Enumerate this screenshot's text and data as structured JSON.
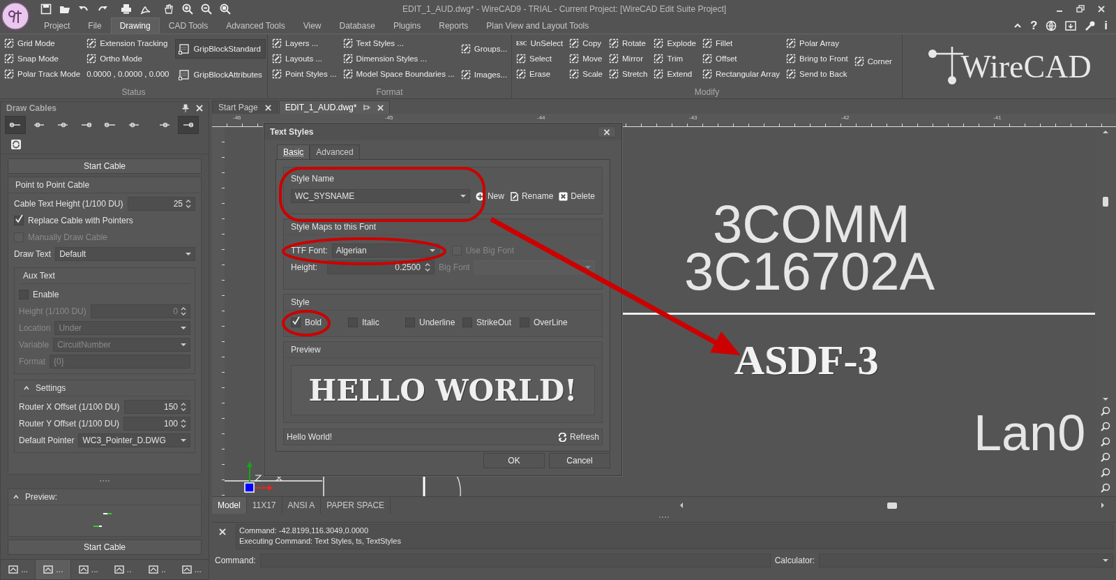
{
  "title_bar": {
    "title": "EDIT_1_AUD.dwg* - WireCAD9 - TRIAL - Current Project: [WireCAD Edit Suite Project]",
    "help": "?",
    "info": "i"
  },
  "menu_tabs": [
    {
      "label": "Project",
      "selected": false
    },
    {
      "label": "File",
      "selected": false
    },
    {
      "label": "Drawing",
      "selected": true
    },
    {
      "label": "CAD Tools",
      "selected": false
    },
    {
      "label": "Advanced Tools",
      "selected": false
    },
    {
      "label": "View",
      "selected": false
    },
    {
      "label": "Database",
      "selected": false
    },
    {
      "label": "Plugins",
      "selected": false
    },
    {
      "label": "Reports",
      "selected": false
    },
    {
      "label": "Plan View and Layout Tools",
      "selected": false
    }
  ],
  "ribbon": {
    "groups": [
      {
        "title": "Status",
        "columns": [
          {
            "items": [
              {
                "kind": "command",
                "label": "Grid Mode"
              },
              {
                "kind": "command",
                "label": "Snap Mode"
              },
              {
                "kind": "command",
                "label": "Polar Track Mode"
              }
            ]
          },
          {
            "items": [
              {
                "kind": "command",
                "label": "Extension Tracking"
              },
              {
                "kind": "command",
                "label": "Ortho Mode"
              },
              {
                "kind": "readout",
                "label": "0.0000 , 0.0000 , 0.000"
              }
            ]
          },
          {
            "items": [
              {
                "kind": "toggle",
                "label": "GripBlockStandard",
                "on": true
              },
              {
                "kind": "toggle",
                "label": "GripBlockAttributes",
                "on": false
              }
            ]
          }
        ]
      },
      {
        "title": "Format",
        "columns": [
          {
            "items": [
              {
                "kind": "command",
                "label": "Layers ..."
              },
              {
                "kind": "command",
                "label": "Layouts ..."
              },
              {
                "kind": "command",
                "label": "Point Styles ..."
              }
            ]
          },
          {
            "items": [
              {
                "kind": "command",
                "label": "Text Styles ..."
              },
              {
                "kind": "command",
                "label": "Dimension Styles ..."
              },
              {
                "kind": "command",
                "label": "Model Space Boundaries ..."
              }
            ]
          },
          {
            "items": [
              {
                "kind": "command",
                "label": "Groups..."
              },
              {
                "kind": "command",
                "label": "Images..."
              }
            ]
          }
        ]
      },
      {
        "title": "Modify",
        "columns": [
          {
            "items": [
              {
                "kind": "command",
                "label": "UnSelect",
                "key": "ESC"
              },
              {
                "kind": "command",
                "label": "Select"
              },
              {
                "kind": "command",
                "label": "Erase"
              }
            ]
          },
          {
            "items": [
              {
                "kind": "command",
                "label": "Copy"
              },
              {
                "kind": "command",
                "label": "Move"
              },
              {
                "kind": "command",
                "label": "Scale"
              }
            ]
          },
          {
            "items": [
              {
                "kind": "command",
                "label": "Rotate"
              },
              {
                "kind": "command",
                "label": "Mirror"
              },
              {
                "kind": "command",
                "label": "Stretch"
              }
            ]
          },
          {
            "items": [
              {
                "kind": "command",
                "label": "Explode"
              },
              {
                "kind": "command",
                "label": "Trim"
              },
              {
                "kind": "command",
                "label": "Extend"
              }
            ]
          },
          {
            "items": [
              {
                "kind": "command",
                "label": "Fillet"
              },
              {
                "kind": "command",
                "label": "Offset"
              },
              {
                "kind": "command",
                "label": "Rectangular Array"
              }
            ]
          },
          {
            "items": [
              {
                "kind": "command",
                "label": "Polar Array"
              },
              {
                "kind": "command",
                "label": "Bring to Front"
              },
              {
                "kind": "command",
                "label": "Send to Back"
              }
            ]
          },
          {
            "items": [
              {
                "kind": "command",
                "label": "Corner"
              }
            ]
          }
        ]
      }
    ]
  },
  "brand": "WireCAD",
  "panel": {
    "title": "Draw Cables",
    "tools": [
      {
        "selected": true
      },
      {
        "selected": false
      },
      {
        "selected": false
      },
      {
        "selected": false
      },
      {
        "selected": false
      },
      {
        "selected": false
      },
      {
        "selected": false
      },
      {
        "selected": true
      }
    ],
    "start_top": "Start Cable",
    "section_title": "Point to Point Cable",
    "rows": [
      {
        "kind": "spin",
        "label": "Cable Text Height (1/100 DU)",
        "value": "25",
        "disabled": false
      },
      {
        "kind": "check",
        "label": "Replace Cable with Pointers",
        "checked": true,
        "disabled": false
      },
      {
        "kind": "check",
        "label": "Manually Draw Cable",
        "checked": false,
        "disabled": true
      },
      {
        "kind": "select",
        "label": "Draw Text",
        "value": "Default",
        "disabled": false
      }
    ],
    "aux": {
      "title": "Aux Text",
      "rows": [
        {
          "kind": "check",
          "label": "Enable",
          "checked": false,
          "disabled": false
        },
        {
          "kind": "spin",
          "label": "Height  (1/100 DU)",
          "value": "0",
          "disabled": true
        },
        {
          "kind": "select",
          "label": "Location",
          "value": "Under",
          "disabled": true
        },
        {
          "kind": "select",
          "label": "Variable",
          "value": "CircuitNumber",
          "disabled": true
        },
        {
          "kind": "text",
          "label": "Format",
          "value": "{0}",
          "disabled": true
        }
      ]
    },
    "settings": {
      "title": "Settings",
      "expanded": true,
      "rows": [
        {
          "kind": "spin",
          "label": "Router X Offset  (1/100 DU)",
          "value": "150",
          "disabled": false
        },
        {
          "kind": "spin",
          "label": "Router Y Offset  (1/100 DU)",
          "value": "100",
          "disabled": false
        },
        {
          "kind": "select",
          "label": "Default Pointer",
          "value": "WC3_Pointer_D.DWG",
          "disabled": false
        }
      ]
    },
    "preview": {
      "title": "Preview:",
      "expanded": true
    },
    "start_bottom": "Start Cable",
    "bottom_tabs": [
      {
        "label": "...",
        "selected": false
      },
      {
        "label": "...",
        "selected": true
      },
      {
        "label": "...",
        "selected": false
      },
      {
        "label": "..",
        "selected": false
      },
      {
        "label": "..",
        "selected": false
      },
      {
        "label": "...",
        "selected": false
      }
    ]
  },
  "doc_tabs": [
    {
      "label": "Start Page",
      "selected": false
    },
    {
      "label": "EDIT_1_AUD.dwg*",
      "selected": true
    }
  ],
  "ruler_labels": [
    "-46",
    "-45",
    "-44",
    "-43",
    "-42",
    "-41"
  ],
  "canvas": {
    "texts": [
      {
        "kind": "label",
        "text": "3COMM"
      },
      {
        "kind": "label",
        "text": "3C16702A"
      },
      {
        "kind": "tag",
        "text": "ASDF-3"
      },
      {
        "kind": "label",
        "text": "Lan0"
      }
    ]
  },
  "layout_tabs": [
    {
      "label": "Model",
      "selected": true
    },
    {
      "label": "11X17",
      "selected": false
    },
    {
      "label": "ANSI A",
      "selected": false
    },
    {
      "label": "PAPER SPACE",
      "selected": false
    }
  ],
  "command": {
    "lines": [
      "Command: -42.8199,116.3049,0.0000",
      "Executing Command: Text Styles, ts, TextStyles"
    ],
    "label": "Command:",
    "calculator_label": "Calculator:"
  },
  "dialog": {
    "title": "Text Styles",
    "tabs": [
      {
        "label": "Basic",
        "selected": true
      },
      {
        "label": "Advanced",
        "selected": false
      }
    ],
    "style_name": {
      "title": "Style Name",
      "value": "WC_SYSNAME",
      "buttons": [
        "New",
        "Rename",
        "Delete"
      ]
    },
    "font": {
      "title": "Style Maps to this Font",
      "ttf_label": "TTF Font:",
      "ttf_value": "Algerian",
      "big_font_check": {
        "label": "Use Big Font",
        "checked": false,
        "disabled": true
      },
      "height_label": "Height:",
      "height_value": "0.2500",
      "big_font_label": "Big Font",
      "big_font_disabled": true
    },
    "style": {
      "title": "Style",
      "options": [
        {
          "label": "Bold",
          "checked": true
        },
        {
          "label": "Italic",
          "checked": false
        },
        {
          "label": "Underline",
          "checked": false
        },
        {
          "label": "StrikeOut",
          "checked": false
        },
        {
          "label": "OverLine",
          "checked": false
        }
      ]
    },
    "preview": {
      "title": "Preview",
      "sample": "HELLO WORLD!"
    },
    "sample_text": "Hello World!",
    "refresh": "Refresh",
    "buttons": [
      "OK",
      "Cancel"
    ]
  }
}
